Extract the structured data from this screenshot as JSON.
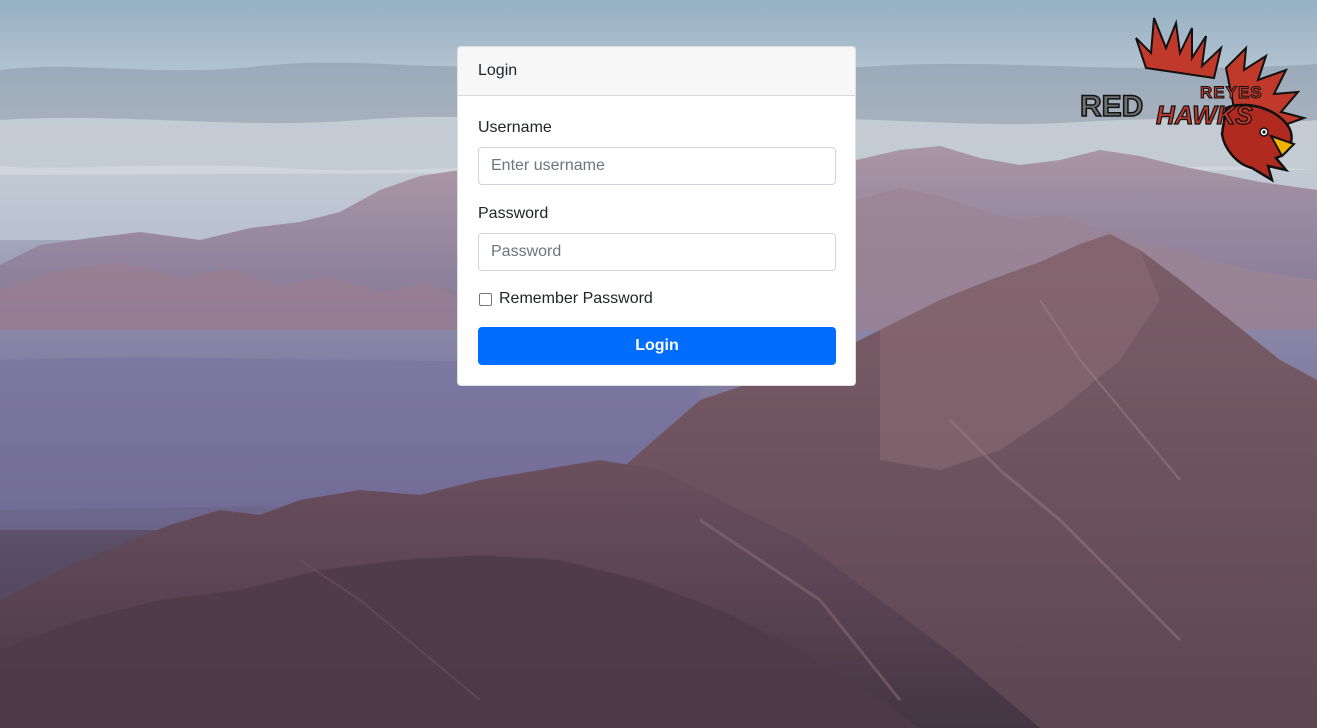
{
  "card": {
    "title": "Login"
  },
  "form": {
    "username_label": "Username",
    "username_placeholder": "Enter username",
    "username_value": "",
    "password_label": "Password",
    "password_placeholder": "Password",
    "password_value": "",
    "remember_label": "Remember Password",
    "remember_checked": false,
    "submit_label": "Login"
  },
  "logo": {
    "top_text": "REYES",
    "main_text_left": "RED",
    "main_text_right": "HAWKS",
    "icon": "redhawk-mascot-icon"
  },
  "colors": {
    "primary_button": "#006dfe",
    "card_header": "#f7f7f7",
    "logo_red": "#c0392b"
  }
}
